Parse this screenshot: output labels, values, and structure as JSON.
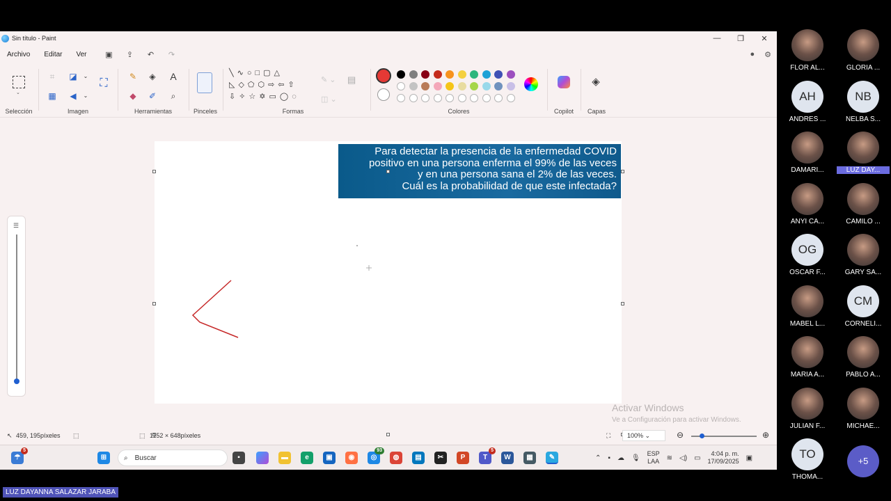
{
  "window": {
    "title": "Sin título - Paint",
    "controls": [
      "—",
      "❐",
      "✕"
    ]
  },
  "menu": [
    "Archivo",
    "Editar",
    "Ver"
  ],
  "ribbon": {
    "groups": [
      "Selección",
      "Imagen",
      "Herramientas",
      "Pinceles",
      "Formas",
      "Colores",
      "Copilot",
      "Capas"
    ],
    "active_color": "#e53935",
    "palette_row1": [
      "#000000",
      "#7f7f7f",
      "#880015",
      "#c42b1c",
      "#f7931e",
      "#f4d03f",
      "#2eb67d",
      "#1fa2d6",
      "#3f51b5",
      "#9c4fbf"
    ],
    "palette_row2": [
      "empty",
      "#c3c3c3",
      "#b97a57",
      "#f4a7b9",
      "#f5c518",
      "#e8dca0",
      "#a5d64a",
      "#99d9ea",
      "#7092be",
      "#c8bfe7"
    ],
    "palette_row3": [
      "empty",
      "empty",
      "empty",
      "empty",
      "empty",
      "empty",
      "empty",
      "empty",
      "empty",
      "empty"
    ]
  },
  "slide": {
    "lines": [
      "Para detectar la presencia de la enfermedad  COVID",
      "positivo en una persona enferma el 99% de las veces",
      "y en una persona sana el 2% de las veces.",
      "Cuál es la probabilidad de que este infectada?"
    ]
  },
  "watermark": {
    "line1": "Activar Windows",
    "line2": "Ve a Configuración para activar Windows."
  },
  "status": {
    "cursor": "459, 195píxeles",
    "canvas_size": "1152 × 648píxeles",
    "zoom": "100%"
  },
  "taskbar": {
    "search": "Buscar",
    "lang": "ESP",
    "lang2": "LAA",
    "time": "4:04 p. m.",
    "date": "17/09/2025",
    "badge_start": "5",
    "badge_edge": "93",
    "badge_pp": "5"
  },
  "participants": [
    {
      "name": "FLOR AL...",
      "kind": "photo"
    },
    {
      "name": "GLORIA ...",
      "kind": "photo"
    },
    {
      "name": "ANDRES ...",
      "kind": "initials",
      "initials": "AH"
    },
    {
      "name": "NELBA S...",
      "kind": "initials",
      "initials": "NB"
    },
    {
      "name": "DAMARI...",
      "kind": "photo"
    },
    {
      "name": "LUZ DAY...",
      "kind": "photo",
      "highlight": true
    },
    {
      "name": "ANYI CA...",
      "kind": "photo"
    },
    {
      "name": "CAMILO ...",
      "kind": "photo"
    },
    {
      "name": "OSCAR F...",
      "kind": "initials",
      "initials": "OG"
    },
    {
      "name": "GARY SA...",
      "kind": "photo"
    },
    {
      "name": "MABEL L...",
      "kind": "photo"
    },
    {
      "name": "CORNELI...",
      "kind": "initials",
      "initials": "CM"
    },
    {
      "name": "MARIA A...",
      "kind": "photo"
    },
    {
      "name": "PABLO A...",
      "kind": "photo"
    },
    {
      "name": "JULIAN F...",
      "kind": "photo"
    },
    {
      "name": "MICHAE...",
      "kind": "photo"
    },
    {
      "name": "THOMA...",
      "kind": "initials",
      "initials": "TO"
    },
    {
      "name": "",
      "kind": "more",
      "initials": "+5"
    }
  ],
  "presenter": "LUZ DAYANNA SALAZAR JARABA"
}
